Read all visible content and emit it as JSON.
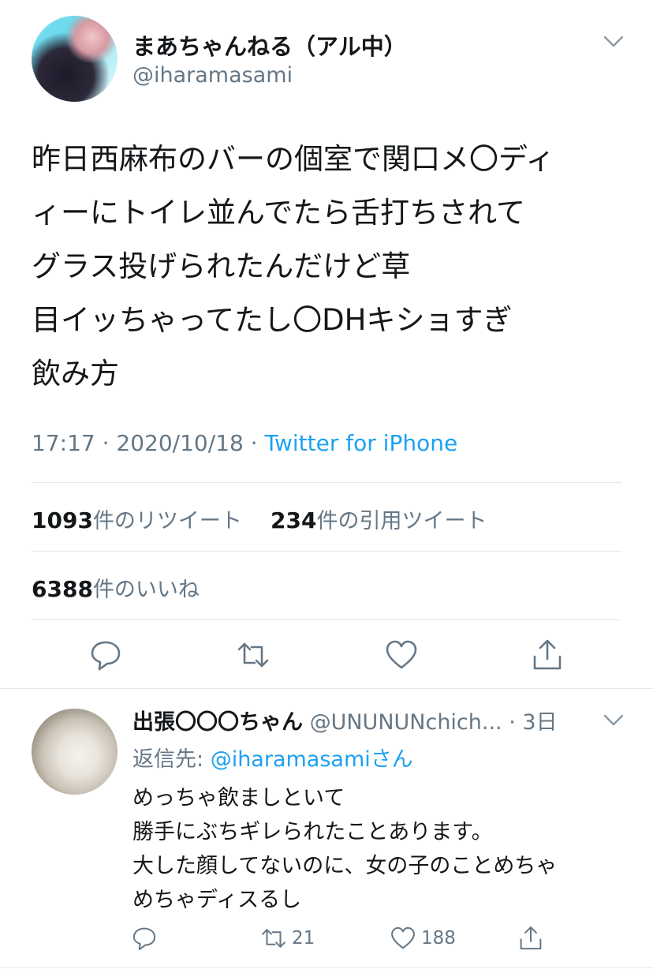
{
  "tweet": {
    "display_name": "まあちゃんねる（アル中）",
    "handle": "@iharamasami",
    "text": "昨日西麻布のバーの個室で関口メ〇ディ\nィーにトイレ並んでたら舌打ちされて\nグラス投げられたんだけど草\n目イッちゃってたし〇DHキショすぎ\n飲み方",
    "time": "17:17",
    "date": "2020/10/18",
    "source": "Twitter for iPhone",
    "retweets_count": "1093",
    "retweets_label": "件のリツイート",
    "quotes_count": "234",
    "quotes_label": "件の引用ツイート",
    "likes_count": "6388",
    "likes_label": "件のいいね"
  },
  "reply": {
    "display_name": "出張〇〇〇ちゃん",
    "handle": "@UNUNUNchich...",
    "separator": "·",
    "age": "3日",
    "reply_prefix": "返信先: ",
    "reply_mention": "@iharamasami",
    "reply_suffix": "さん",
    "text": "めっちゃ飲ましといて\n勝手にぶちギレられたことあります。\n大した顔してないのに、女の子のことめちゃ\nめちゃディスるし",
    "retweet_count": "21",
    "like_count": "188"
  },
  "icons": {
    "menu": "chevron-down-icon",
    "reply": "comment-icon",
    "retweet": "retweet-icon",
    "like": "heart-icon",
    "share": "share-icon"
  },
  "colors": {
    "text": "#14171a",
    "secondary": "#657786",
    "accent": "#1da1f2",
    "divider": "#e1e8ed"
  }
}
